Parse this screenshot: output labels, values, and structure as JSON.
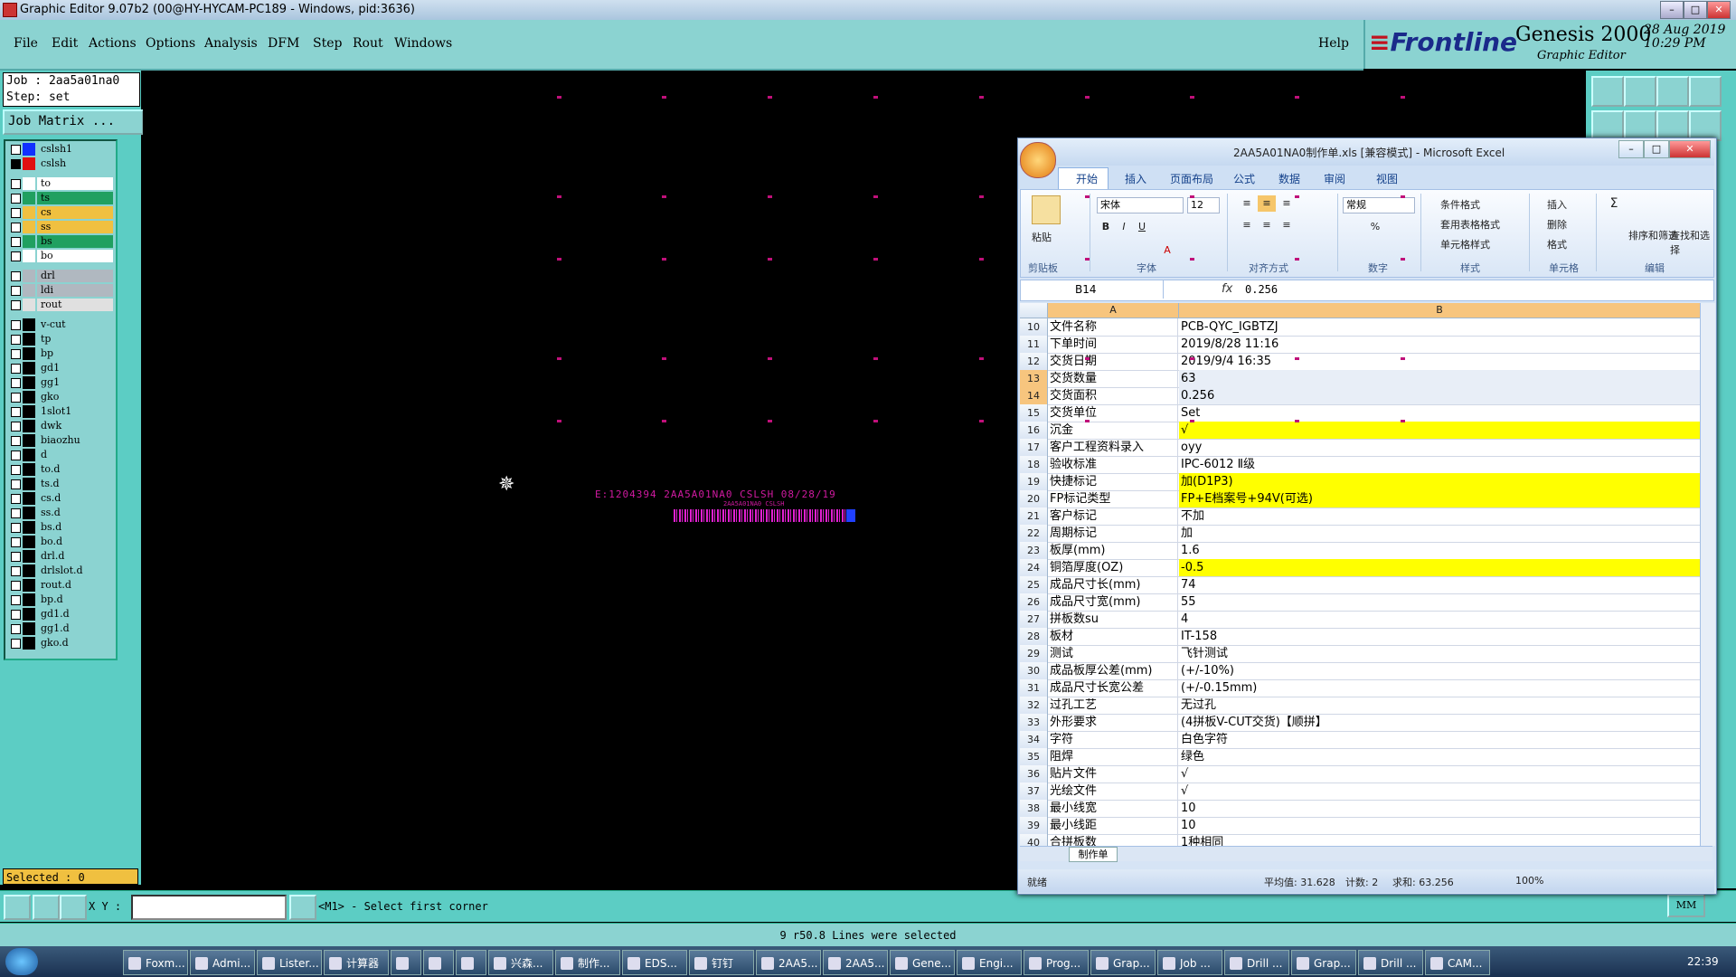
{
  "window": {
    "title": "Graphic Editor 9.07b2 (00@HY-HYCAM-PC189 - Windows, pid:3636)"
  },
  "menu": [
    "File",
    "Edit",
    "Actions",
    "Options",
    "Analysis",
    "DFM",
    "Step",
    "Rout",
    "Windows"
  ],
  "help": "Help",
  "brand": {
    "logo": "Frontline",
    "product": "Genesis 2000",
    "subtitle": "Graphic Editor",
    "date": "28 Aug 2019",
    "time": "10:29 PM"
  },
  "job": {
    "job_line": "Job : 2aa5a01na0",
    "step_line": "Step: set",
    "matrix_button": "Job Matrix ..."
  },
  "layers": [
    {
      "name": "cslsh1",
      "swatch": "#1030ff",
      "bg": "#8bd3d1"
    },
    {
      "name": "cslsh",
      "swatch": "#e01010",
      "bg": "#8bd3d1",
      "active": true
    },
    {
      "name": "to",
      "swatch": "#ffffff",
      "bg": "#ffffff"
    },
    {
      "name": "ts",
      "swatch": "#20a060",
      "bg": "#20a060"
    },
    {
      "name": "cs",
      "swatch": "#f0c040",
      "bg": "#f0c040"
    },
    {
      "name": "ss",
      "swatch": "#f0c040",
      "bg": "#f0c040"
    },
    {
      "name": "bs",
      "swatch": "#20a060",
      "bg": "#20a060"
    },
    {
      "name": "bo",
      "swatch": "#ffffff",
      "bg": "#ffffff"
    },
    {
      "name": "drl",
      "swatch": "#b0b8c0",
      "bg": "#b0b8c0"
    },
    {
      "name": "ldi",
      "swatch": "#b0b8c0",
      "bg": "#b0b8c0"
    },
    {
      "name": "rout",
      "swatch": "#e0e0e0",
      "bg": "#e0e0e0"
    },
    {
      "name": "v-cut",
      "bg": "#8bd3d1"
    },
    {
      "name": "tp",
      "bg": "#8bd3d1"
    },
    {
      "name": "bp",
      "bg": "#8bd3d1"
    },
    {
      "name": "gd1",
      "bg": "#8bd3d1"
    },
    {
      "name": "gg1",
      "bg": "#8bd3d1"
    },
    {
      "name": "gko",
      "bg": "#8bd3d1"
    },
    {
      "name": "1slot1",
      "bg": "#8bd3d1"
    },
    {
      "name": "dwk",
      "bg": "#8bd3d1"
    },
    {
      "name": "biaozhu",
      "bg": "#8bd3d1"
    },
    {
      "name": "d",
      "bg": "#8bd3d1"
    },
    {
      "name": "to.d",
      "bg": "#8bd3d1"
    },
    {
      "name": "ts.d",
      "bg": "#8bd3d1"
    },
    {
      "name": "cs.d",
      "bg": "#8bd3d1"
    },
    {
      "name": "ss.d",
      "bg": "#8bd3d1"
    },
    {
      "name": "bs.d",
      "bg": "#8bd3d1"
    },
    {
      "name": "bo.d",
      "bg": "#8bd3d1"
    },
    {
      "name": "drl.d",
      "bg": "#8bd3d1"
    },
    {
      "name": "drlslot.d",
      "bg": "#8bd3d1"
    },
    {
      "name": "rout.d",
      "bg": "#8bd3d1"
    },
    {
      "name": "bp.d",
      "bg": "#8bd3d1"
    },
    {
      "name": "gd1.d",
      "bg": "#8bd3d1"
    },
    {
      "name": "gg1.d",
      "bg": "#8bd3d1"
    },
    {
      "name": "gko.d",
      "bg": "#8bd3d1"
    }
  ],
  "selected": "Selected : 0",
  "canvas": {
    "text_line": "E:1204394 2AA5A01NA0 CSLSH 08/28/19",
    "text_small": "2AA5A01NA0 CSLSH",
    "cursor_icon": "crosshair-icon"
  },
  "command": {
    "xy_label": "X Y :",
    "xy_value": "",
    "prompt": "<M1> - Select first corner",
    "units": "MM"
  },
  "status": "9 r50.8 Lines were selected",
  "excel": {
    "title": "2AA5A01NA0制作单.xls [兼容模式] - Microsoft Excel",
    "tabs": [
      "开始",
      "插入",
      "页面布局",
      "公式",
      "数据",
      "审阅",
      "视图"
    ],
    "font_name": "宋体",
    "font_size": "12",
    "number_format": "常规",
    "groups": [
      "剪贴板",
      "字体",
      "对齐方式",
      "数字",
      "样式",
      "单元格",
      "编辑"
    ],
    "ribbon_labels": {
      "paste": "粘贴",
      "cond_format": "条件格式",
      "table_format": "套用表格格式",
      "cell_style": "单元格样式",
      "insert": "插入",
      "delete": "删除",
      "format": "格式",
      "sort": "排序和筛选",
      "find": "查找和选择"
    },
    "name_box": "B14",
    "fx": "fx",
    "formula": "0.256",
    "col_a": "A",
    "col_b": "B",
    "rows": [
      {
        "n": "10",
        "a": "文件名称",
        "b": "PCB-QYC_IGBTZJ"
      },
      {
        "n": "11",
        "a": "下单时间",
        "b": "2019/8/28 11:16"
      },
      {
        "n": "12",
        "a": "交货日期",
        "b": "2019/9/4 16:35"
      },
      {
        "n": "13",
        "a": "交货数量",
        "b": "63",
        "sel": true
      },
      {
        "n": "14",
        "a": "交货面积",
        "b": "0.256",
        "sel": true
      },
      {
        "n": "15",
        "a": "交货单位",
        "b": "Set"
      },
      {
        "n": "16",
        "a": "沉金",
        "b": "√",
        "yellow": true
      },
      {
        "n": "17",
        "a": "客户工程资料录入",
        "b": "oyy"
      },
      {
        "n": "18",
        "a": "验收标准",
        "b": "IPC-6012 Ⅱ级"
      },
      {
        "n": "19",
        "a": "快捷标记",
        "b": "加(D1P3)",
        "yellow": true
      },
      {
        "n": "20",
        "a": "FP标记类型",
        "b": "FP+E档案号+94V(可选)",
        "yellow": true
      },
      {
        "n": "21",
        "a": "客户标记",
        "b": "不加"
      },
      {
        "n": "22",
        "a": "周期标记",
        "b": "加"
      },
      {
        "n": "23",
        "a": "板厚(mm)",
        "b": "1.6"
      },
      {
        "n": "24",
        "a": "铜箔厚度(OZ)",
        "b": "-0.5",
        "yellow": true
      },
      {
        "n": "25",
        "a": "成品尺寸长(mm)",
        "b": "74"
      },
      {
        "n": "26",
        "a": "成品尺寸宽(mm)",
        "b": "55"
      },
      {
        "n": "27",
        "a": "拼板数su",
        "b": "4"
      },
      {
        "n": "28",
        "a": "板材",
        "b": "IT-158"
      },
      {
        "n": "29",
        "a": "测试",
        "b": "飞针测试"
      },
      {
        "n": "30",
        "a": "成品板厚公差(mm)",
        "b": "(+/-10%)"
      },
      {
        "n": "31",
        "a": "成品尺寸长宽公差",
        "b": "(+/-0.15mm)"
      },
      {
        "n": "32",
        "a": "过孔工艺",
        "b": "无过孔"
      },
      {
        "n": "33",
        "a": "外形要求",
        "b": "(4拼板V-CUT交货)【顺拼】"
      },
      {
        "n": "34",
        "a": "字符",
        "b": "白色字符"
      },
      {
        "n": "35",
        "a": "阻焊",
        "b": "绿色"
      },
      {
        "n": "36",
        "a": "贴片文件",
        "b": "√"
      },
      {
        "n": "37",
        "a": "光绘文件",
        "b": "√"
      },
      {
        "n": "38",
        "a": "最小线宽",
        "b": "10"
      },
      {
        "n": "39",
        "a": "最小线距",
        "b": "10"
      },
      {
        "n": "40",
        "a": "合拼板数",
        "b": "1种相同"
      }
    ],
    "sheet_tab": "制作单",
    "status_ready": "就绪",
    "status_avg": "平均值: 31.628",
    "status_count": "计数: 2",
    "status_sum": "求和: 63.256",
    "zoom": "100%"
  },
  "taskbar": {
    "items": [
      "Foxm...",
      "Admi...",
      "Lister...",
      "计算器",
      "",
      "",
      "",
      "兴森...",
      "制作...",
      "EDS...",
      "钉钉",
      "2AA5...",
      "2AA5...",
      "Gene...",
      "Engi...",
      "Prog...",
      "Grap...",
      "Job ...",
      "Drill ...",
      "Grap...",
      "Drill ...",
      "CAM..."
    ],
    "clock": "22:39"
  }
}
